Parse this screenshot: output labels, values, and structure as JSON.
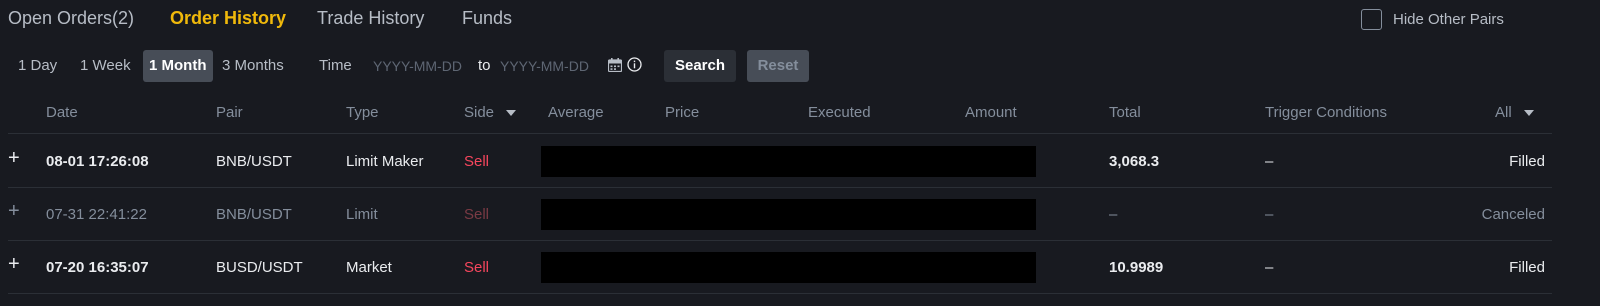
{
  "tabs": [
    {
      "label": "Open Orders(2)"
    },
    {
      "label": "Order History"
    },
    {
      "label": "Trade History"
    },
    {
      "label": "Funds"
    }
  ],
  "hide_other_pairs": {
    "label": "Hide Other Pairs",
    "checked": false
  },
  "filters": {
    "periods": [
      {
        "label": "1 Day"
      },
      {
        "label": "1 Week"
      },
      {
        "label": "1 Month"
      },
      {
        "label": "3 Months"
      }
    ],
    "selected_period": "1 Month",
    "time_label": "Time",
    "date_from_placeholder": "YYYY-MM-DD",
    "to_label": "to",
    "date_to_placeholder": "YYYY-MM-DD",
    "search_label": "Search",
    "reset_label": "Reset"
  },
  "columns": {
    "date": "Date",
    "pair": "Pair",
    "type": "Type",
    "side": "Side",
    "average": "Average",
    "price": "Price",
    "executed": "Executed",
    "amount": "Amount",
    "total": "Total",
    "trigger": "Trigger Conditions",
    "status_filter": "All"
  },
  "rows": [
    {
      "expand": "+",
      "date": "08-01 17:26:08",
      "pair": "BNB/USDT",
      "type": "Limit Maker",
      "side": "Sell",
      "total": "3,068.3",
      "trigger": "–",
      "status": "Filled"
    },
    {
      "expand": "+",
      "date": "07-31 22:41:22",
      "pair": "BNB/USDT",
      "type": "Limit",
      "side": "Sell",
      "total": "–",
      "trigger": "–",
      "status": "Canceled"
    },
    {
      "expand": "+",
      "date": "07-20 16:35:07",
      "pair": "BUSD/USDT",
      "type": "Market",
      "side": "Sell",
      "total": "10.9989",
      "trigger": "–",
      "status": "Filled"
    }
  ],
  "colors": {
    "background": "#181a20",
    "accent": "#f0b90b",
    "sell": "#f6465d",
    "muted": "#848e9c"
  }
}
